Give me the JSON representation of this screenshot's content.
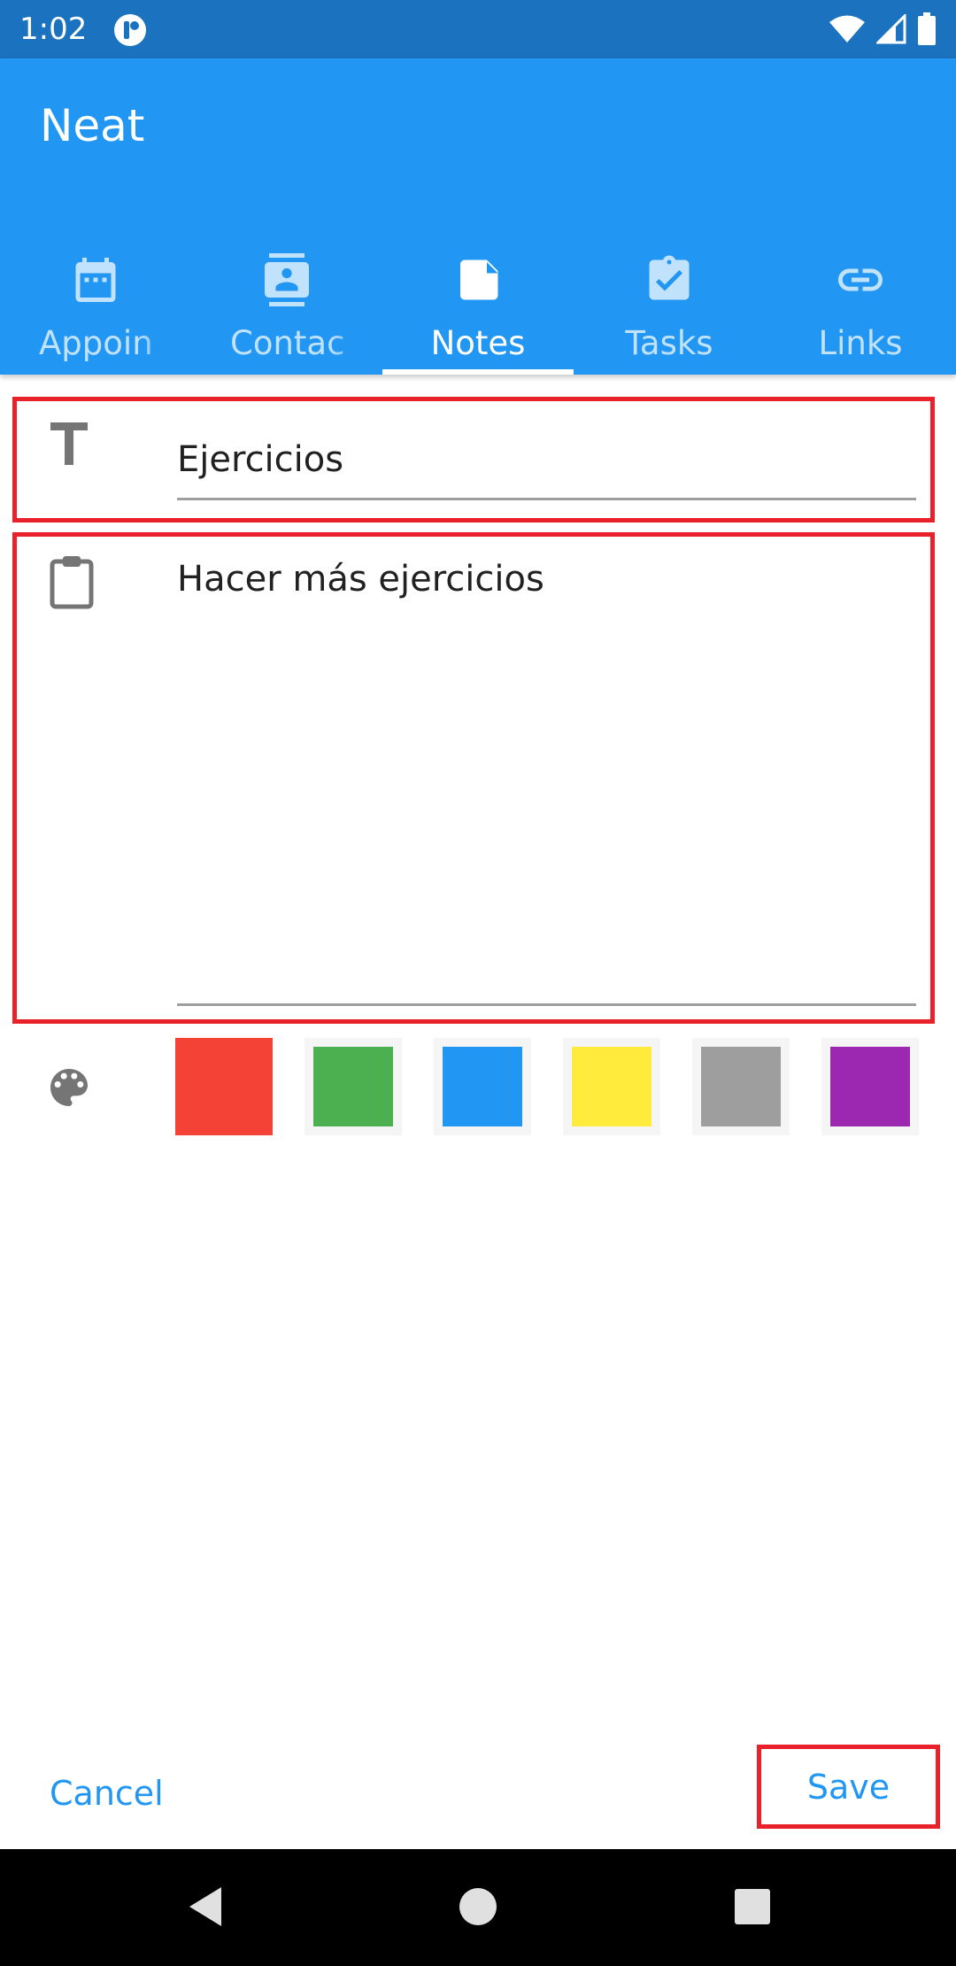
{
  "status_bar": {
    "time": "1:02"
  },
  "app": {
    "title": "Neat"
  },
  "tabs": [
    {
      "label": "Appoin",
      "icon": "calendar-icon"
    },
    {
      "label": "Contac",
      "icon": "contact-card-icon"
    },
    {
      "label": "Notes",
      "icon": "note-icon",
      "active": true
    },
    {
      "label": "Tasks",
      "icon": "task-check-icon"
    },
    {
      "label": "Links",
      "icon": "link-icon"
    }
  ],
  "note": {
    "title_value": "Ejercicios",
    "content_value": "Hacer más ejercicios"
  },
  "colors": {
    "accent": "#2196f3",
    "status_bar": "#1b72bf",
    "highlight": "#e8212b",
    "swatches": [
      "#f44336",
      "#4caf50",
      "#2196f3",
      "#ffeb3b",
      "#9e9e9e",
      "#9c27b0"
    ],
    "selected_swatch": "#f44336"
  },
  "actions": {
    "cancel_label": "Cancel",
    "save_label": "Save"
  }
}
